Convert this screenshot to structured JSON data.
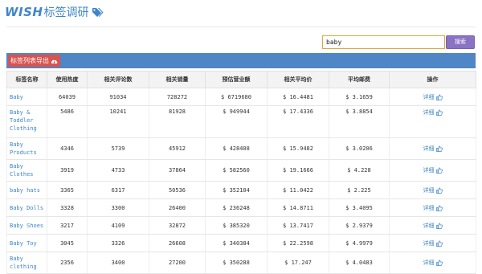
{
  "header": {
    "brand": "WISH",
    "title": "标签调研",
    "icon": "tags-icon"
  },
  "search": {
    "value": "baby",
    "button_label": "搜索"
  },
  "toolbar": {
    "export_label": "标签列表导出",
    "export_icon": "cloud-download-icon"
  },
  "table": {
    "columns": [
      "标签名称",
      "使用热度",
      "相关评论数",
      "相关销量",
      "预估营业额",
      "相关平均价",
      "平均邮费",
      "操作"
    ],
    "rows": [
      {
        "name": "Baby",
        "heat": "64039",
        "reviews": "91034",
        "sales": "728272",
        "revenue": "$ 6719680",
        "avg_price": "$ 16.4481",
        "shipping": "$ 3.1659",
        "action": "详细"
      },
      {
        "name": "Baby & Toddler Clothing",
        "heat": "5486",
        "reviews": "10241",
        "sales": "81928",
        "revenue": "$ 949944",
        "avg_price": "$ 17.4336",
        "shipping": "$ 3.8854",
        "action": "详细"
      },
      {
        "name": "Baby Products",
        "heat": "4346",
        "reviews": "5739",
        "sales": "45912",
        "revenue": "$ 428408",
        "avg_price": "$ 15.9482",
        "shipping": "$ 3.0206",
        "action": "详细"
      },
      {
        "name": "Baby Clothes",
        "heat": "3919",
        "reviews": "4733",
        "sales": "37864",
        "revenue": "$ 582560",
        "avg_price": "$ 19.1666",
        "shipping": "$ 4.228",
        "action": "详细"
      },
      {
        "name": "baby hats",
        "heat": "3365",
        "reviews": "6317",
        "sales": "50536",
        "revenue": "$ 352104",
        "avg_price": "$ 11.0422",
        "shipping": "$ 2.225",
        "action": "详细"
      },
      {
        "name": "Baby Dolls",
        "heat": "3328",
        "reviews": "3300",
        "sales": "26400",
        "revenue": "$ 236248",
        "avg_price": "$ 14.8711",
        "shipping": "$ 3.4095",
        "action": "详细"
      },
      {
        "name": "Baby Shoes",
        "heat": "3217",
        "reviews": "4109",
        "sales": "32872",
        "revenue": "$ 385320",
        "avg_price": "$ 13.7417",
        "shipping": "$ 2.9379",
        "action": "详细"
      },
      {
        "name": "Baby Toy",
        "heat": "3045",
        "reviews": "3326",
        "sales": "26608",
        "revenue": "$ 340384",
        "avg_price": "$ 22.2598",
        "shipping": "$ 4.9979",
        "action": "详细"
      },
      {
        "name": "Baby clothing",
        "heat": "2356",
        "reviews": "3400",
        "sales": "27200",
        "revenue": "$ 350288",
        "avg_price": "$ 17.247",
        "shipping": "$ 4.0483",
        "action": "详细"
      }
    ]
  },
  "colors": {
    "accent": "#3f86c8",
    "bar": "#4f86c6",
    "export": "#d9534f",
    "search_button": "#8a73c2",
    "search_border": "#e0a640"
  }
}
